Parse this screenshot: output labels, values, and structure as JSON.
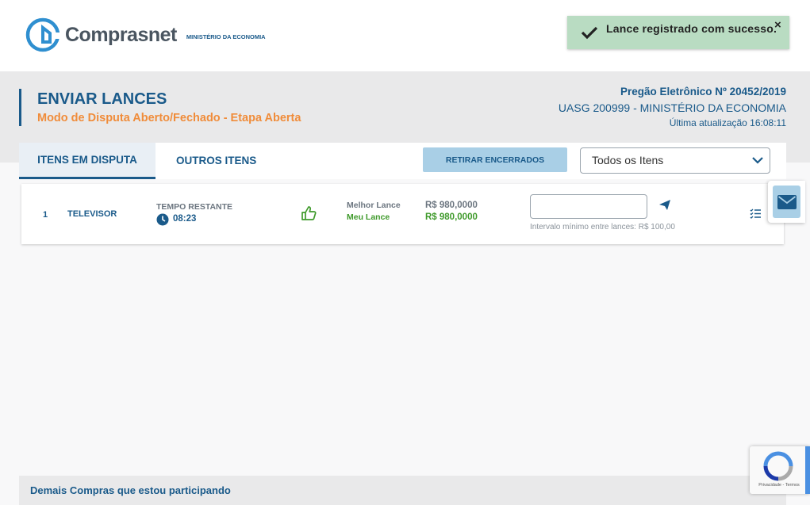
{
  "header": {
    "brand": "Comprasnet",
    "ministry": "MINISTÉRIO DA ECONOMIA"
  },
  "toast": {
    "message": "Lance registrado com sucesso.",
    "close": "×"
  },
  "page": {
    "title": "ENVIAR LANCES",
    "subtitle": "Modo de Disputa Aberto/Fechado - Etapa Aberta",
    "pregao": "Pregão Eletrônico Nº 20452/2019",
    "uasg": "UASG 200999 - MINISTÉRIO DA ECONOMIA",
    "updated": "Última atualização 16:08:11"
  },
  "tabs": {
    "active": "ITENS EM DISPUTA",
    "other": "OUTROS ITENS",
    "retirar": "RETIRAR ENCERRADOS",
    "filter_selected": "Todos os Itens"
  },
  "item": {
    "number": "1",
    "name": "TELEVISOR",
    "time_label": "TEMPO RESTANTE",
    "time_value": "08:23",
    "best_label": "Melhor Lance",
    "my_label": "Meu Lance",
    "best_value": "R$ 980,0000",
    "my_value": "R$ 980,0000",
    "bid_value": "",
    "hint": "Intervalo mínimo entre lances: R$ 100,00"
  },
  "footer": {
    "text": "Demais Compras que estou participando"
  },
  "recaptcha": {
    "text": "Privacidade - Termos"
  },
  "colors": {
    "primary": "#1a5a8a",
    "accent": "#f08c3a",
    "success": "#3f9a2b",
    "toast_bg": "#b9dcc2",
    "button_bg": "#a9cfe6"
  }
}
